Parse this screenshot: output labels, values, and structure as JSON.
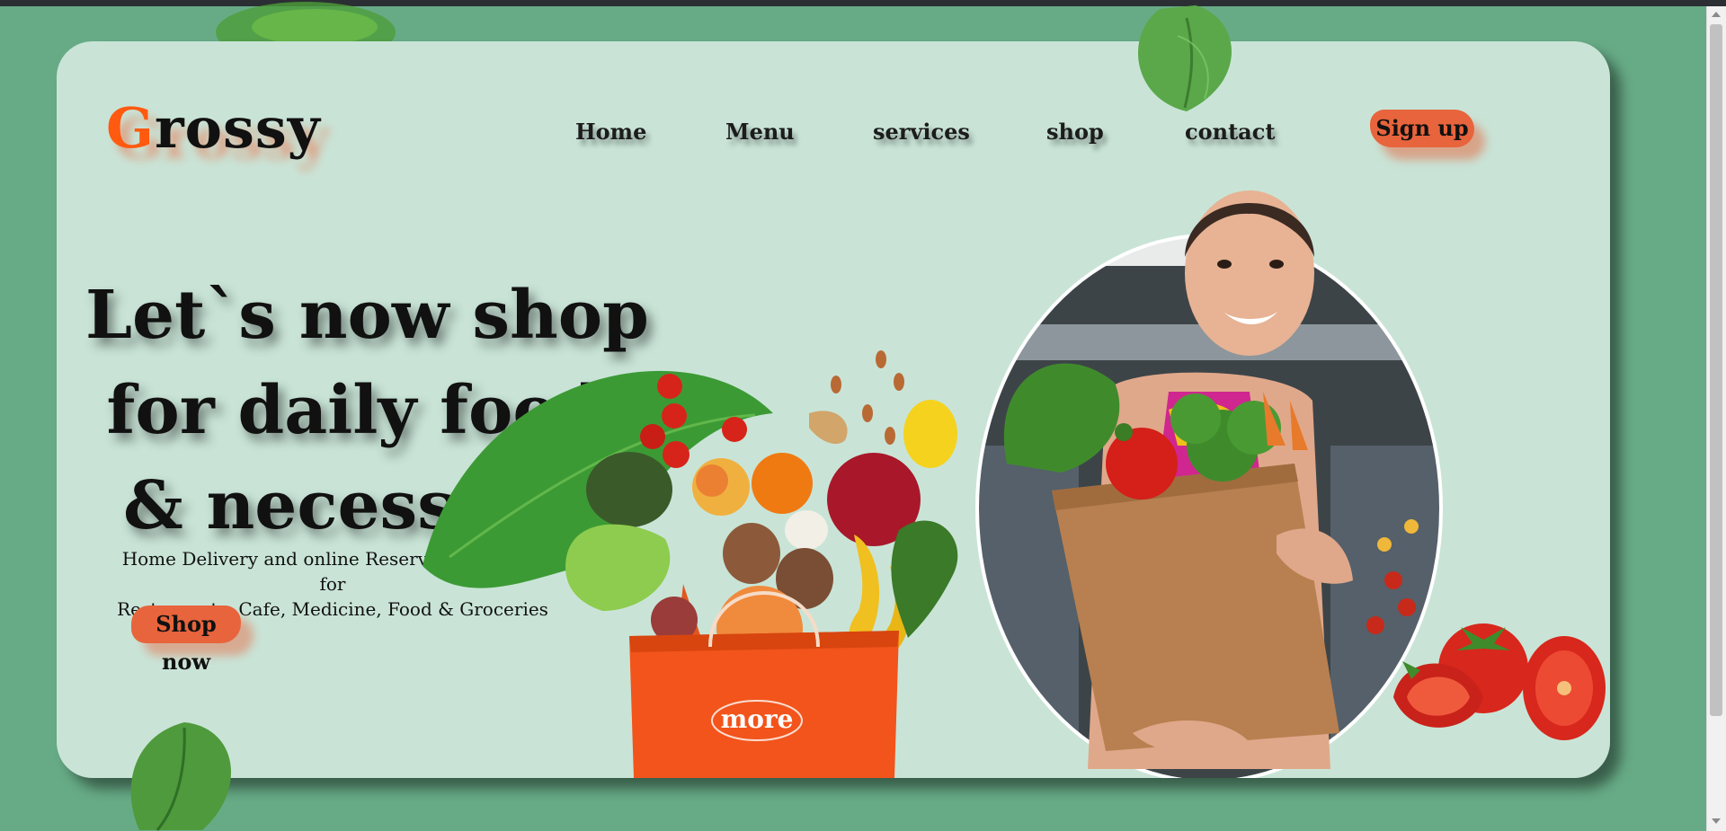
{
  "brand": {
    "first_letter": "G",
    "rest": "rossy"
  },
  "nav": {
    "items": [
      "Home",
      "Menu",
      "services",
      "shop",
      "contact"
    ],
    "signup_label": "Sign up"
  },
  "hero": {
    "headline": [
      "Let`s now shop",
      "for daily food",
      "& necessary."
    ],
    "subtext": [
      "Home Delivery and online Reservation system for",
      "Restaurents, Cafe, Medicine, Food & Groceries"
    ],
    "cta_label": "Shop now"
  },
  "bag": {
    "text": "more"
  },
  "colors": {
    "page_bg": "#67ab86",
    "card_bg": "#c9e4d7",
    "accent": "#e8643c",
    "logo_accent": "#ff5a10"
  }
}
